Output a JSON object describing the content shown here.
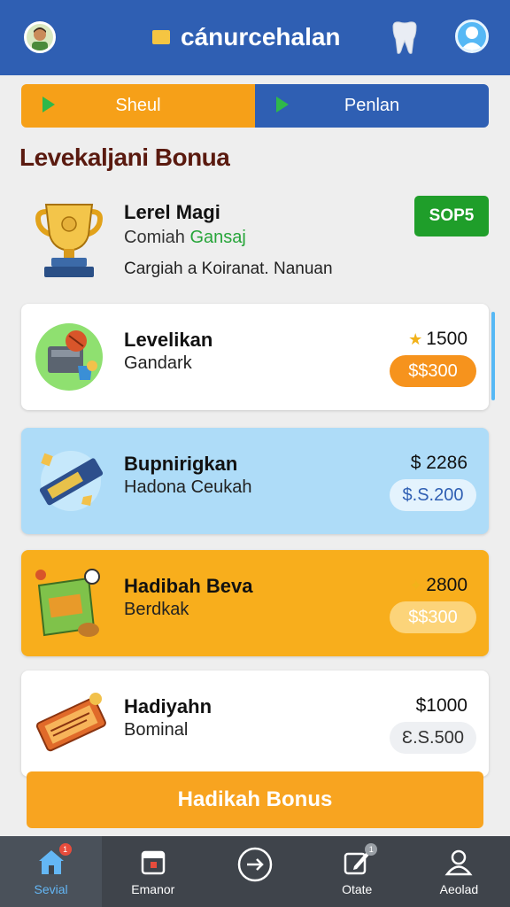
{
  "header": {
    "title": "cánurcehalan",
    "avatar_icon": "user-avatar-icon",
    "tooth_icon": "tooth-icon",
    "profile_icon": "profile-icon"
  },
  "tabs": [
    {
      "label": "Sheul",
      "icon": "play-icon"
    },
    {
      "label": "Penlan",
      "icon": "play-icon"
    }
  ],
  "section_title": "Levekaljani Bonua",
  "featured": {
    "name": "Lerel Magi",
    "sub_prefix": "Comiah ",
    "sub_highlight": "Gansaj",
    "description": "Cargiah a Koiranat. Nanuan",
    "badge": "SOP5",
    "icon": "trophy-icon"
  },
  "rewards": [
    {
      "name": "Levelikan",
      "subtitle": "Gandark",
      "price": "1500",
      "price_prefix": "★",
      "pill": "$$300",
      "style": "white",
      "icon": "gift-machine-icon"
    },
    {
      "name": "Bupnirigkan",
      "subtitle": "Hadona Ceukah",
      "price": "$ 2286",
      "price_prefix": "",
      "pill": "$.S.200",
      "style": "blue",
      "icon": "ticket-icon"
    },
    {
      "name": "Hadibah Beva",
      "subtitle": "Berdkak",
      "price": "2800",
      "price_prefix": "✦",
      "pill": "$$300",
      "style": "orange",
      "icon": "coupon-icon"
    },
    {
      "name": "Hadiyahn",
      "subtitle": "Bominal",
      "price": "$1000",
      "price_prefix": "",
      "pill": "Ɛ.S.500",
      "style": "white",
      "icon": "voucher-icon"
    }
  ],
  "cta": {
    "label": "Hadikah Bonus"
  },
  "bottom_nav": [
    {
      "label": "Sevial",
      "icon": "home-icon",
      "active": true,
      "badge": "1"
    },
    {
      "label": "Emanor",
      "icon": "calendar-icon",
      "active": false,
      "badge": ""
    },
    {
      "label": "",
      "icon": "arrow-right-circle-icon",
      "active": false,
      "badge": ""
    },
    {
      "label": "Otate",
      "icon": "edit-icon",
      "active": false,
      "badge": "1"
    },
    {
      "label": "Aeolad",
      "icon": "person-icon",
      "active": false,
      "badge": ""
    }
  ],
  "colors": {
    "header": "#2f5fb3",
    "accent_orange": "#f6a018",
    "green_badge": "#1f9e2a",
    "card_blue": "#aedcf8",
    "card_orange": "#f8ae1c",
    "bottom_bar": "#3f444b"
  }
}
